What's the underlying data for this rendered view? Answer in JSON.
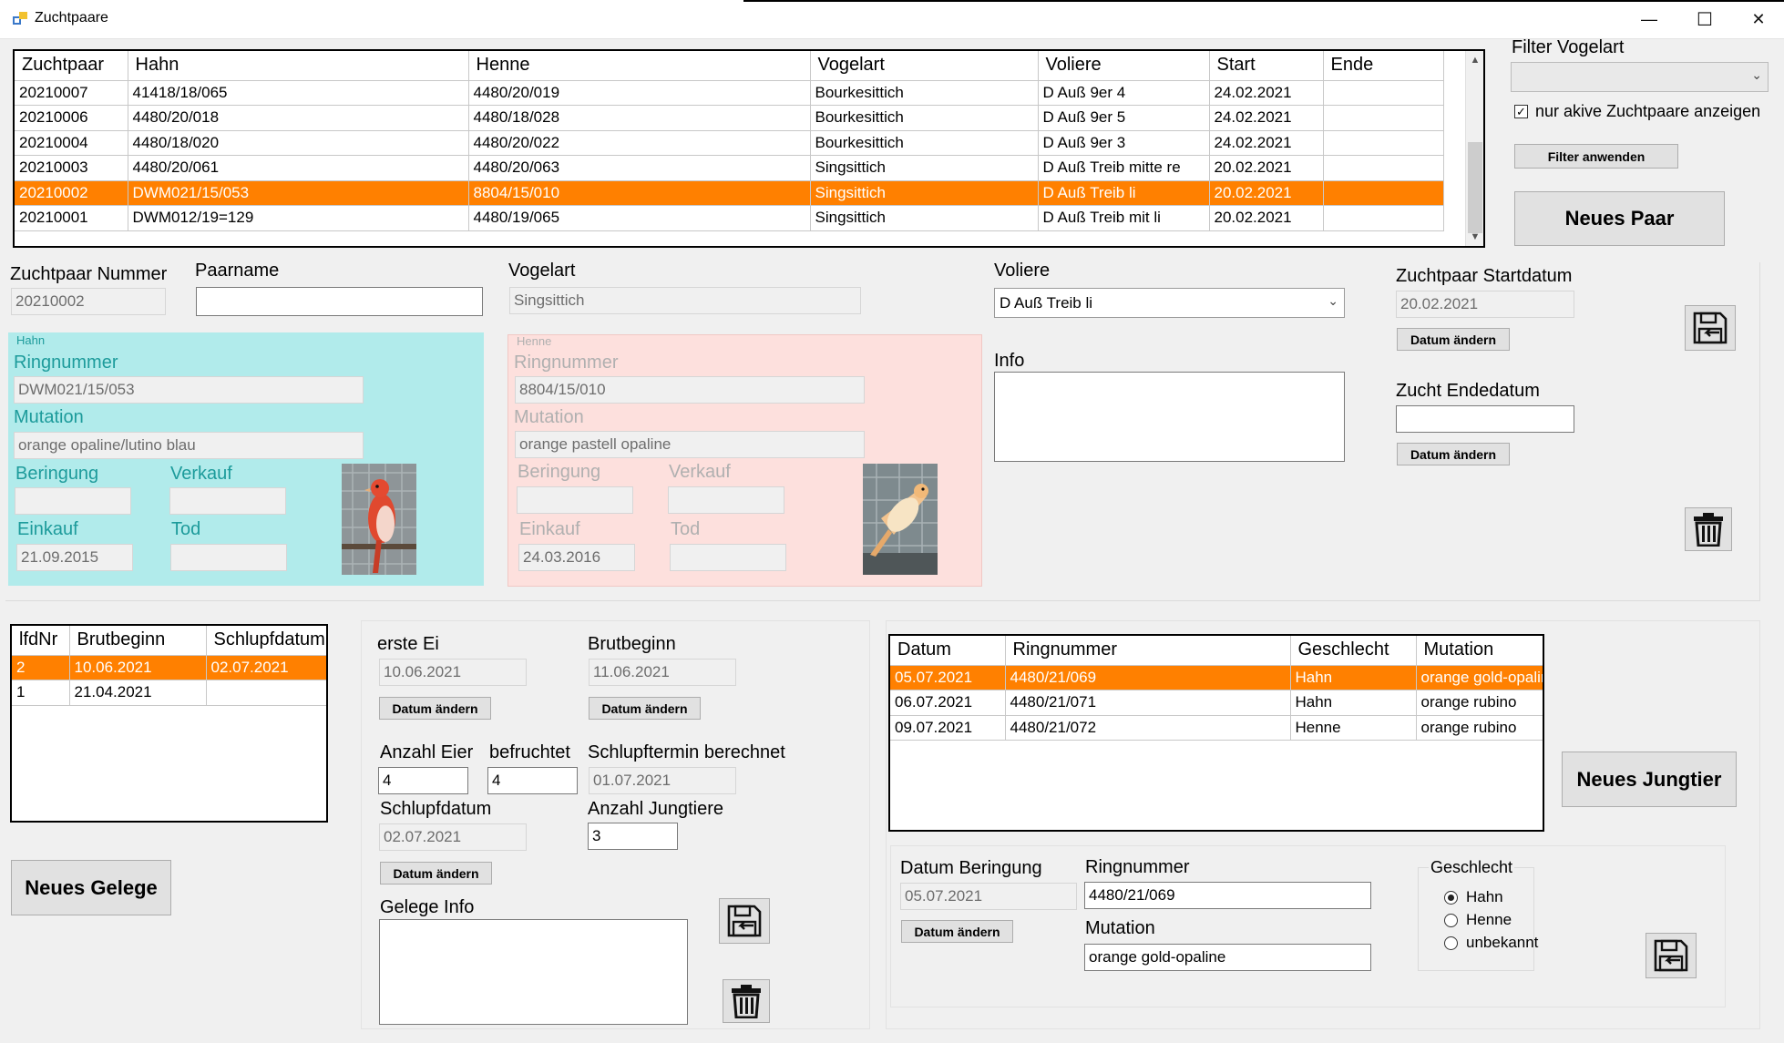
{
  "window": {
    "title": "Zuchtpaare",
    "min": "—",
    "max": "☐",
    "close": "✕"
  },
  "pairs_grid": {
    "columns": [
      "Zuchtpaar",
      "Hahn",
      "Henne",
      "Vogelart",
      "Voliere",
      "Start",
      "Ende"
    ],
    "rows": [
      [
        "20210007",
        "41418/18/065",
        "4480/20/019",
        "Bourkesittich",
        "D Auß 9er 4",
        "24.02.2021",
        ""
      ],
      [
        "20210006",
        "4480/20/018",
        "4480/18/028",
        "Bourkesittich",
        "D Auß 9er 5",
        "24.02.2021",
        ""
      ],
      [
        "20210004",
        "4480/18/020",
        "4480/20/022",
        "Bourkesittich",
        "D Auß 9er 3",
        "24.02.2021",
        ""
      ],
      [
        "20210003",
        "4480/20/061",
        "4480/20/063",
        "Singsittich",
        "D Auß Treib mitte re",
        "20.02.2021",
        ""
      ],
      [
        "20210002",
        "DWM021/15/053",
        "8804/15/010",
        "Singsittich",
        "D Auß Treib li",
        "20.02.2021",
        ""
      ],
      [
        "20210001",
        "DWM012/19=129",
        "4480/19/065",
        "Singsittich",
        "D Auß Treib mit li",
        "20.02.2021",
        ""
      ]
    ],
    "selected_index": 4
  },
  "filter": {
    "label": "Filter Vogelart",
    "value": "",
    "only_active_label": "nur akive Zuchtpaare anzeigen",
    "only_active_checked": true,
    "apply_button": "Filter anwenden",
    "new_pair_button": "Neues Paar"
  },
  "pair_detail": {
    "number_label": "Zuchtpaar Nummer",
    "number": "20210002",
    "name_label": "Paarname",
    "name": "",
    "species_label": "Vogelart",
    "species": "Singsittich",
    "aviary_label": "Voliere",
    "aviary": "D Auß Treib li",
    "info_label": "Info",
    "info": "",
    "start_label": "Zuchtpaar Startdatum",
    "start": "20.02.2021",
    "end_label": "Zucht Endedatum",
    "end": "",
    "change_date_button": "Datum ändern"
  },
  "hahn": {
    "group": "Hahn",
    "ring_label": "Ringnummer",
    "ring": "DWM021/15/053",
    "mutation_label": "Mutation",
    "mutation": "orange opaline/lutino blau",
    "beringung_label": "Beringung",
    "beringung": "",
    "verkauf_label": "Verkauf",
    "verkauf": "",
    "einkauf_label": "Einkauf",
    "einkauf": "21.09.2015",
    "tod_label": "Tod",
    "tod": ""
  },
  "henne": {
    "group": "Henne",
    "ring_label": "Ringnummer",
    "ring": "8804/15/010",
    "mutation_label": "Mutation",
    "mutation": "orange pastell opaline",
    "beringung_label": "Beringung",
    "beringung": "",
    "verkauf_label": "Verkauf",
    "verkauf": "",
    "einkauf_label": "Einkauf",
    "einkauf": "24.03.2016",
    "tod_label": "Tod",
    "tod": ""
  },
  "clutch_grid": {
    "columns": [
      "lfdNr",
      "Brutbeginn",
      "Schlupfdatum"
    ],
    "rows": [
      [
        "2",
        "10.06.2021",
        "02.07.2021"
      ],
      [
        "1",
        "21.04.2021",
        ""
      ]
    ],
    "selected_index": 0
  },
  "clutch": {
    "new_button": "Neues Gelege",
    "first_egg_label": "erste Ei",
    "first_egg": "10.06.2021",
    "brood_start_label": "Brutbeginn",
    "brood_start": "11.06.2021",
    "eggs_label": "Anzahl Eier",
    "eggs": "4",
    "fertilized_label": "befruchtet",
    "fertilized": "4",
    "hatch_calc_label": "Schlupftermin berechnet",
    "hatch_calc": "01.07.2021",
    "hatch_label": "Schlupfdatum",
    "hatch": "02.07.2021",
    "young_count_label": "Anzahl Jungtiere",
    "young_count": "3",
    "info_label": "Gelege Info",
    "info": "",
    "change_date_button": "Datum ändern"
  },
  "young_grid": {
    "columns": [
      "Datum",
      "Ringnummer",
      "Geschlecht",
      "Mutation"
    ],
    "rows": [
      [
        "05.07.2021",
        "4480/21/069",
        "Hahn",
        "orange gold-opaline"
      ],
      [
        "06.07.2021",
        "4480/21/071",
        "Hahn",
        "orange rubino"
      ],
      [
        "09.07.2021",
        "4480/21/072",
        "Henne",
        "orange rubino"
      ]
    ],
    "selected_index": 0
  },
  "young": {
    "new_button": "Neues Jungtier",
    "ringing_date_label": "Datum Beringung",
    "ringing_date": "05.07.2021",
    "ring_label": "Ringnummer",
    "ring": "4480/21/069",
    "mutation_label": "Mutation",
    "mutation": "orange gold-opaline",
    "sex_label": "Geschlecht",
    "sex_options": [
      "Hahn",
      "Henne",
      "unbekannt"
    ],
    "sex_selected": "Hahn",
    "change_date_button": "Datum ändern"
  },
  "icons": {
    "save": "save-icon",
    "trash": "trash-icon"
  },
  "colors": {
    "selection": "#ff8000",
    "hahn_panel": "#b1ebeb",
    "henne_panel": "#fde0dd",
    "teal_text": "#1d9b9b"
  }
}
